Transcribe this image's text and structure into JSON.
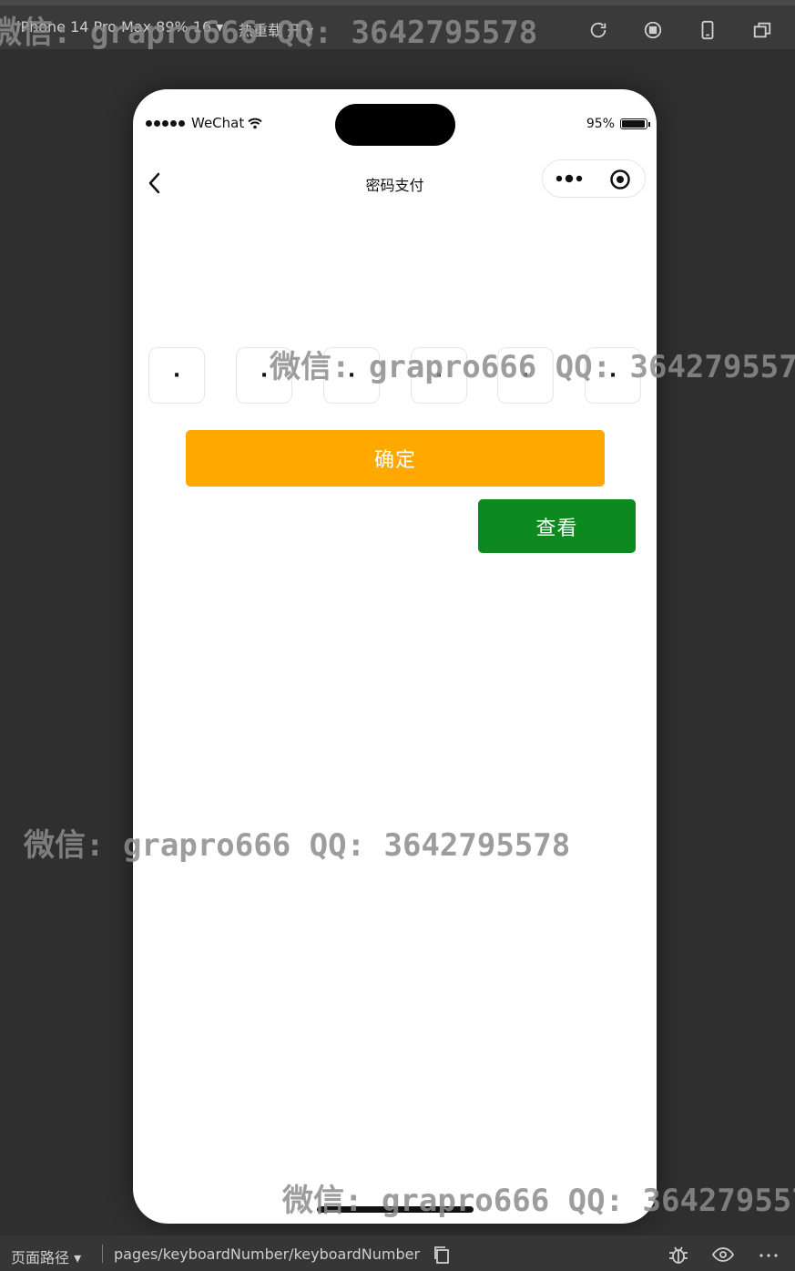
{
  "toolbar": {
    "device_label": "iPhone 14 Pro Max 89% 16 ▾",
    "hot_reload_label": "热重载 开 ▾"
  },
  "status_bar": {
    "carrier": "WeChat",
    "battery_text": "95%",
    "battery_level": 0.95
  },
  "nav_bar": {
    "title": "密码支付"
  },
  "pin": {
    "digits": [
      "·",
      "·",
      "·",
      "·",
      "·",
      "·"
    ]
  },
  "buttons": {
    "confirm_label": "确定",
    "view_label": "查看"
  },
  "colors": {
    "confirm": "#ffa800",
    "view": "#0c8a20"
  },
  "bottom_bar": {
    "path_label": "页面路径 ▾",
    "path_value": "pages/keyboardNumber/keyboardNumber"
  },
  "watermark": {
    "text": "微信: grapro666 QQ: 3642795578"
  }
}
